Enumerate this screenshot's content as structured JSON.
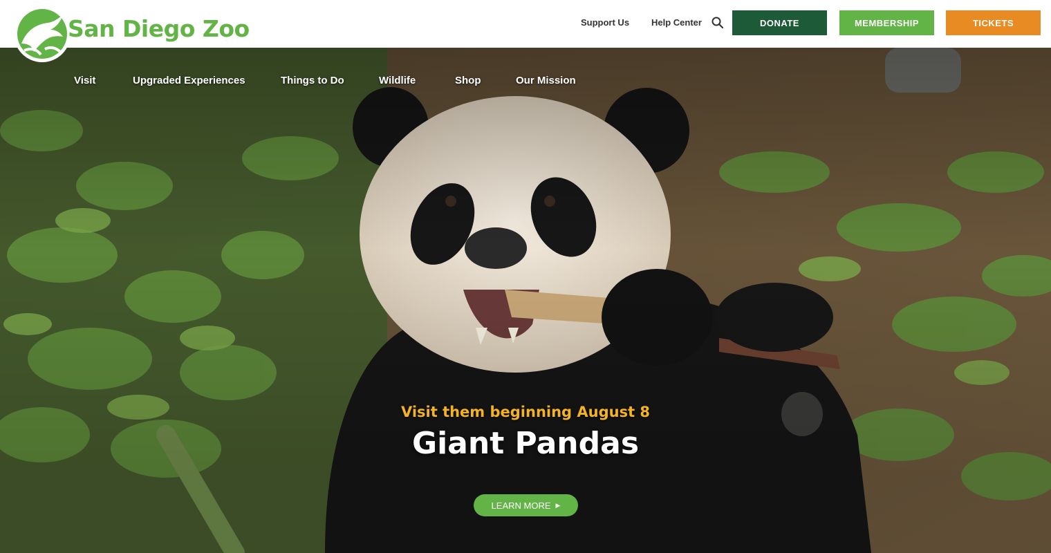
{
  "brand": {
    "name": "San Diego Zoo",
    "color": "#62b446",
    "logo_icon": "leaping-animal-logo"
  },
  "utility_nav": {
    "support_label": "Support Us",
    "help_label": "Help Center",
    "search_icon": "search-icon"
  },
  "cta": {
    "donate_label": "DONATE",
    "membership_label": "MEMBERSHIP",
    "tickets_label": "TICKETS",
    "donate_color": "#1d5a37",
    "membership_color": "#62b446",
    "tickets_color": "#e88b22"
  },
  "main_nav": {
    "items": [
      {
        "label": "Visit"
      },
      {
        "label": "Upgraded Experiences"
      },
      {
        "label": "Things to Do"
      },
      {
        "label": "Wildlife"
      },
      {
        "label": "Shop"
      },
      {
        "label": "Our Mission"
      }
    ]
  },
  "hero": {
    "kicker": "Visit them beginning August 8",
    "title": "Giant Pandas",
    "button_label": "LEARN MORE",
    "button_icon": "play-arrow-icon",
    "kicker_color": "#f3b324",
    "image": "giant-panda-eating-bamboo-photo"
  }
}
